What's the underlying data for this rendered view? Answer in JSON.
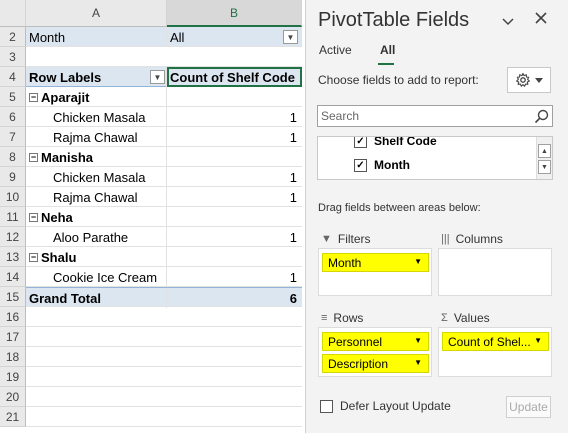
{
  "sheet": {
    "columns": {
      "a": "A",
      "b": "B"
    },
    "row_numbers": [
      "2",
      "3",
      "4",
      "5",
      "6",
      "7",
      "8",
      "9",
      "10",
      "11",
      "12",
      "13",
      "14",
      "15",
      "16",
      "17",
      "18",
      "19",
      "20",
      "21"
    ],
    "filter": {
      "label": "Month",
      "value": "All"
    },
    "header": {
      "row_labels": "Row Labels",
      "count": "Count of Shelf Code"
    },
    "groups": [
      {
        "name": "Aparajit",
        "items": [
          {
            "name": "Chicken Masala",
            "count": "1"
          },
          {
            "name": "Rajma Chawal",
            "count": "1"
          }
        ]
      },
      {
        "name": "Manisha",
        "items": [
          {
            "name": "Chicken Masala",
            "count": "1"
          },
          {
            "name": "Rajma Chawal",
            "count": "1"
          }
        ]
      },
      {
        "name": "Neha",
        "items": [
          {
            "name": "Aloo Parathe",
            "count": "1"
          }
        ]
      },
      {
        "name": "Shalu",
        "items": [
          {
            "name": "Cookie Ice Cream",
            "count": "1"
          }
        ]
      }
    ],
    "grand_total": {
      "label": "Grand Total",
      "count": "6"
    },
    "collapse_glyph": "−",
    "dropdown_glyph": "▼"
  },
  "pane": {
    "title": "PivotTable Fields",
    "tabs": [
      "Active",
      "All"
    ],
    "active_tab": "All",
    "choose_text": "Choose fields to add to report:",
    "search_placeholder": "Search",
    "fields": [
      {
        "label": "Shelf Code",
        "checked": true
      },
      {
        "label": "Month",
        "checked": true
      }
    ],
    "drag_text": "Drag fields between areas below:",
    "areas": {
      "filters": {
        "label": "Filters",
        "items": [
          "Month"
        ]
      },
      "columns": {
        "label": "Columns",
        "items": []
      },
      "rows": {
        "label": "Rows",
        "items": [
          "Personnel",
          "Description"
        ]
      },
      "values": {
        "label": "Values",
        "items": [
          "Count of Shel..."
        ]
      }
    },
    "defer_label": "Defer Layout Update",
    "update_label": "Update",
    "highlight_color": "#ffff00",
    "accent_color": "#217346"
  }
}
